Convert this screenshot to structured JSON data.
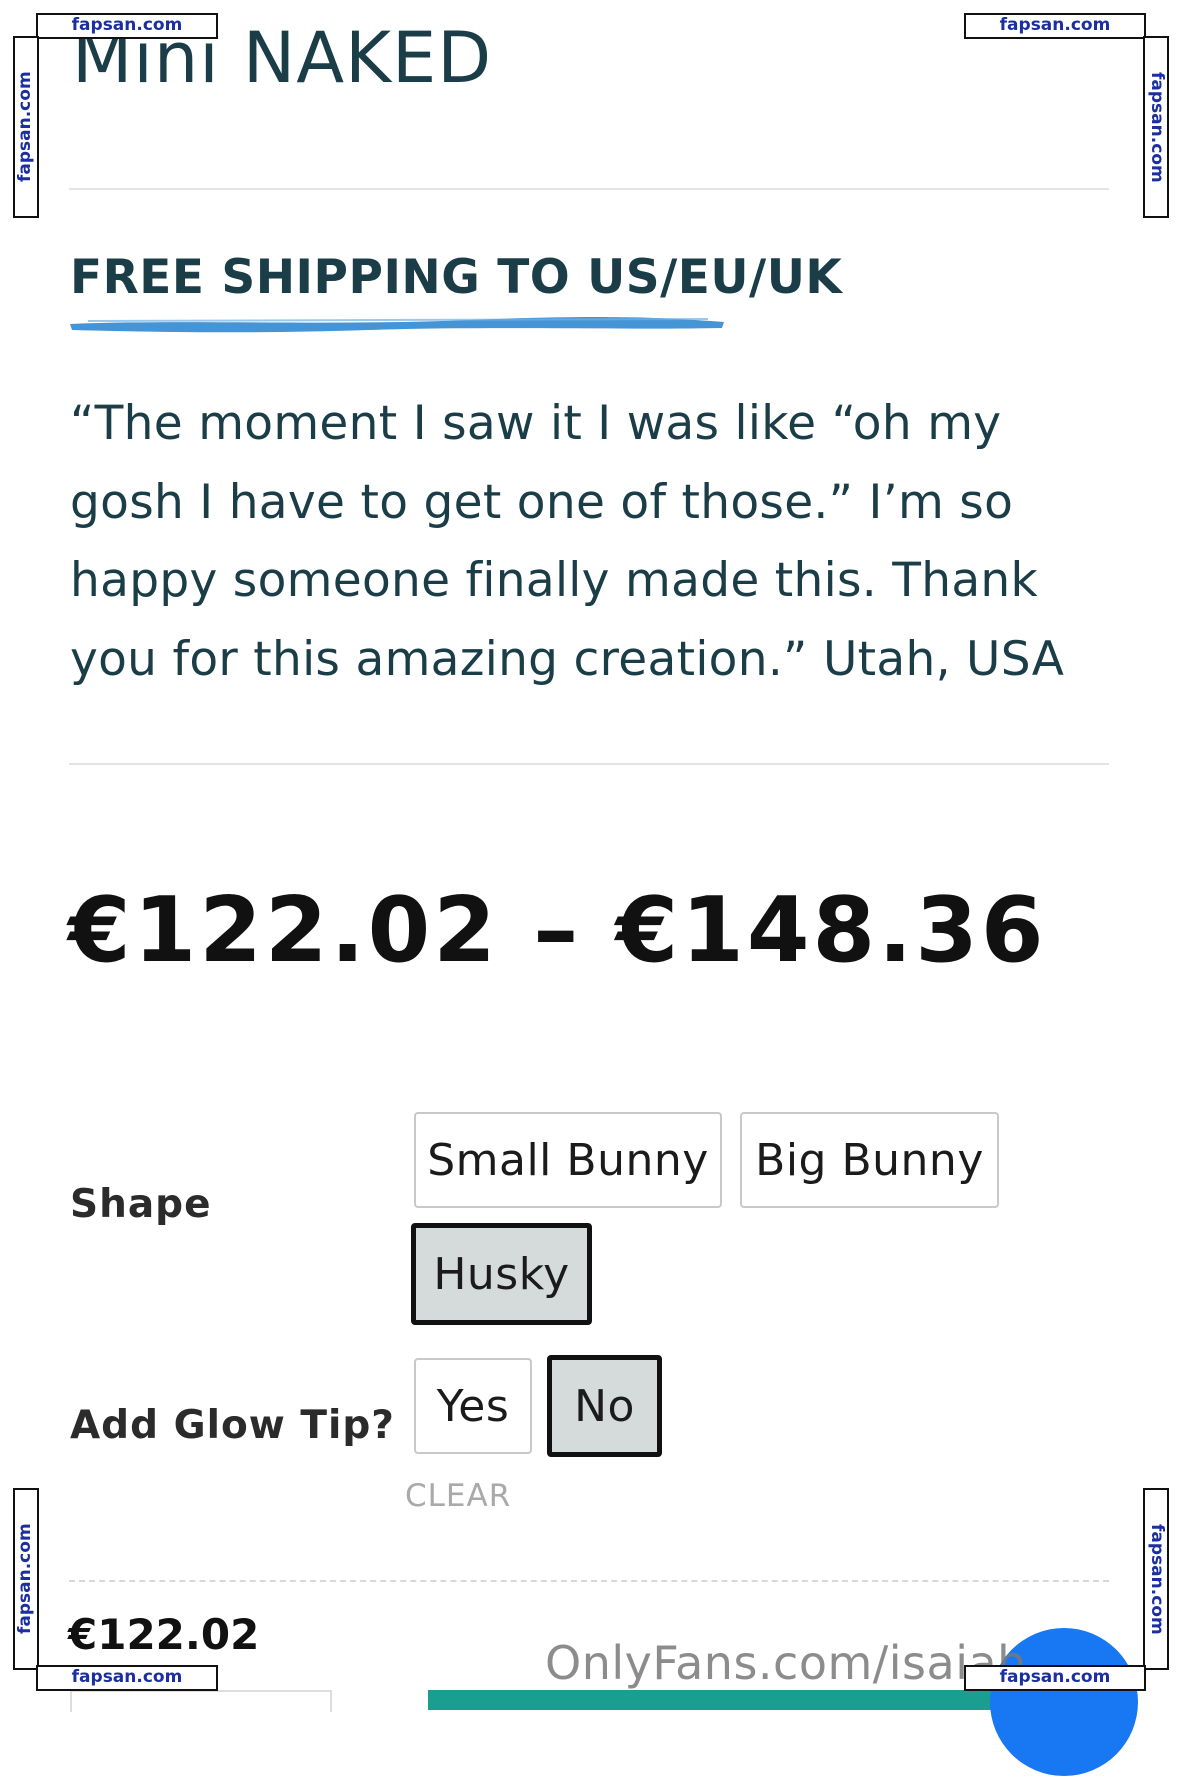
{
  "product": {
    "title": "Mini NAKED",
    "shipping_banner": "FREE SHIPPING TO US/EU/UK",
    "testimonial": "“The moment I saw it I was like “oh my gosh I have to get one of those.” I’m so happy someone finally made this. Thank you for this amazing creation.” Utah, USA",
    "price_range": "€122.02 – €148.36",
    "selected_price": "€122.02"
  },
  "options": {
    "shape": {
      "label": "Shape",
      "choices": [
        "Small Bunny",
        "Big Bunny",
        "Husky"
      ],
      "selected": "Husky"
    },
    "glow_tip": {
      "label": "Add Glow Tip?",
      "choices": [
        "Yes",
        "No"
      ],
      "selected": "No"
    },
    "clear_label": "CLEAR"
  },
  "overlay": {
    "onlyfans_text": "OnlyFans.com/isaiah",
    "watermark": "fapsan.com"
  },
  "colors": {
    "accent_brush": "#3b8fd4",
    "heading_text": "#1a3d47",
    "selected_swatch_bg": "#d5dbdb",
    "cart_button": "#1a9e8f",
    "chat_button": "#1877f2"
  }
}
